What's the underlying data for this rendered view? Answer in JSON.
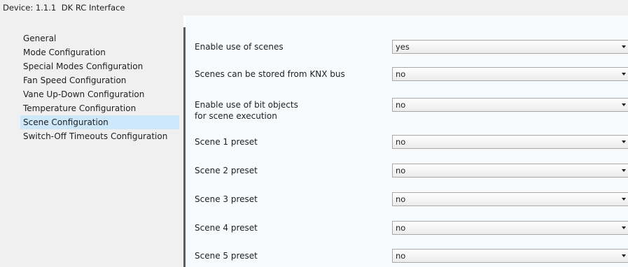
{
  "window": {
    "device_label": "Device:",
    "device_address": "1.1.1",
    "device_name": "DK RC Interface"
  },
  "sidebar": {
    "items": [
      {
        "label": "General",
        "selected": false
      },
      {
        "label": "Mode Configuration",
        "selected": false
      },
      {
        "label": "Special Modes Configuration",
        "selected": false
      },
      {
        "label": "Fan Speed Configuration",
        "selected": false
      },
      {
        "label": "Vane Up-Down Configuration",
        "selected": false
      },
      {
        "label": "Temperature Configuration",
        "selected": false
      },
      {
        "label": "Scene Configuration",
        "selected": true
      },
      {
        "label": "Switch-Off Timeouts Configuration",
        "selected": false
      }
    ]
  },
  "params": [
    {
      "label_line1": "Enable use of scenes",
      "label_line2": "",
      "value": "yes"
    },
    {
      "label_line1": "Scenes can be stored from KNX bus",
      "label_line2": "",
      "value": "no"
    },
    {
      "label_line1": "Enable use of bit objects",
      "label_line2": "for scene execution",
      "value": "no"
    },
    {
      "label_line1": "Scene 1 preset",
      "label_line2": "",
      "value": "no"
    },
    {
      "label_line1": "Scene 2 preset",
      "label_line2": "",
      "value": "no"
    },
    {
      "label_line1": "Scene 3 preset",
      "label_line2": "",
      "value": "no"
    },
    {
      "label_line1": "Scene 4 preset",
      "label_line2": "",
      "value": "no"
    },
    {
      "label_line1": "Scene 5 preset",
      "label_line2": "",
      "value": "no"
    }
  ],
  "icons": {
    "dropdown": "chevron-down-icon"
  },
  "colors": {
    "selected_item_bg": "#cde8fb",
    "panel_bg": "#f8fbfd",
    "sidebar_bg": "#f0f0f0",
    "splitter": "#5d5d5d"
  }
}
